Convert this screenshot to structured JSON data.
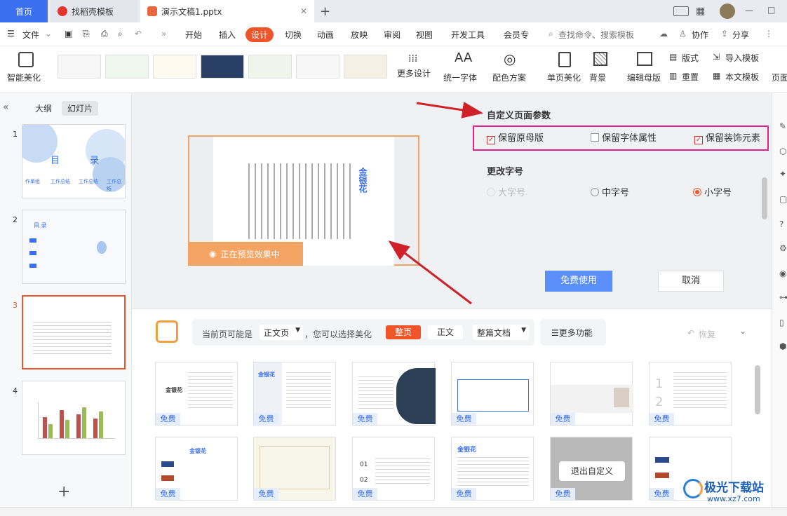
{
  "tabs": {
    "home": "首页",
    "daoke": "找稻壳模板",
    "doc": "演示文稿1.pptx",
    "add": "+"
  },
  "window_controls": {
    "minimize": "—",
    "maximize": "□",
    "close": "✕"
  },
  "menubar": {
    "file": "文件",
    "items": [
      "开始",
      "插入",
      "设计",
      "切换",
      "动画",
      "放映",
      "审阅",
      "视图",
      "开发工具",
      "会员专"
    ],
    "search_placeholder": "查找命令、搜索模板",
    "collab": "协作",
    "share": "分享"
  },
  "ribbon": {
    "smart": "智能美化",
    "more_design": "更多设计",
    "unify_font": "统一字体",
    "color_scheme": "配色方案",
    "page_beautify": "单页美化",
    "background": "背景",
    "edit_master": "编辑母版",
    "layout": "版式",
    "reset": "重置",
    "import_template": "导入模板",
    "text_template": "本文模板",
    "page": "页面"
  },
  "leftpanel": {
    "tab_outline": "大纲",
    "tab_slides": "幻灯片",
    "slide_numbers": [
      "1",
      "2",
      "3",
      "4"
    ],
    "add": "+",
    "s1_title_a": "目",
    "s1_title_b": "录",
    "s1_items": [
      "作单组",
      "工作总结",
      "工作总结",
      "工作总结"
    ],
    "s2_title": "目 录"
  },
  "preview": {
    "status": "正在预览效果中",
    "title_vertical": "金银花"
  },
  "custom_params": {
    "title": "自定义页面参数",
    "keep_master": "保留原母版",
    "keep_font": "保留字体属性",
    "keep_decor": "保留装饰元素",
    "font_size_title": "更改字号",
    "large": "大字号",
    "medium": "中字号",
    "small": "小字号",
    "use_free": "免费使用",
    "cancel": "取消"
  },
  "beautify_bar": {
    "prefix": "当前页可能是",
    "page_type": "正文页",
    "middle": "，您可以选择美化",
    "opt_whole": "整页",
    "opt_text": "正文",
    "opt_doc": "整篇文档",
    "more": "更多功能",
    "restore": "恢复"
  },
  "templates": {
    "free": "免费",
    "exit_custom": "退出自定义",
    "card_titles": [
      "金银花",
      "金银花",
      "",
      "",
      "",
      "",
      "金银花",
      "",
      "",
      "金银花",
      "",
      ""
    ]
  },
  "watermark": {
    "name": "极光下载站",
    "url": "www.xz7.com"
  },
  "colors": {
    "accent": "#f0552a",
    "primary": "#3a6ff0",
    "highlight": "#e0218a",
    "arrow": "#d0202a"
  }
}
